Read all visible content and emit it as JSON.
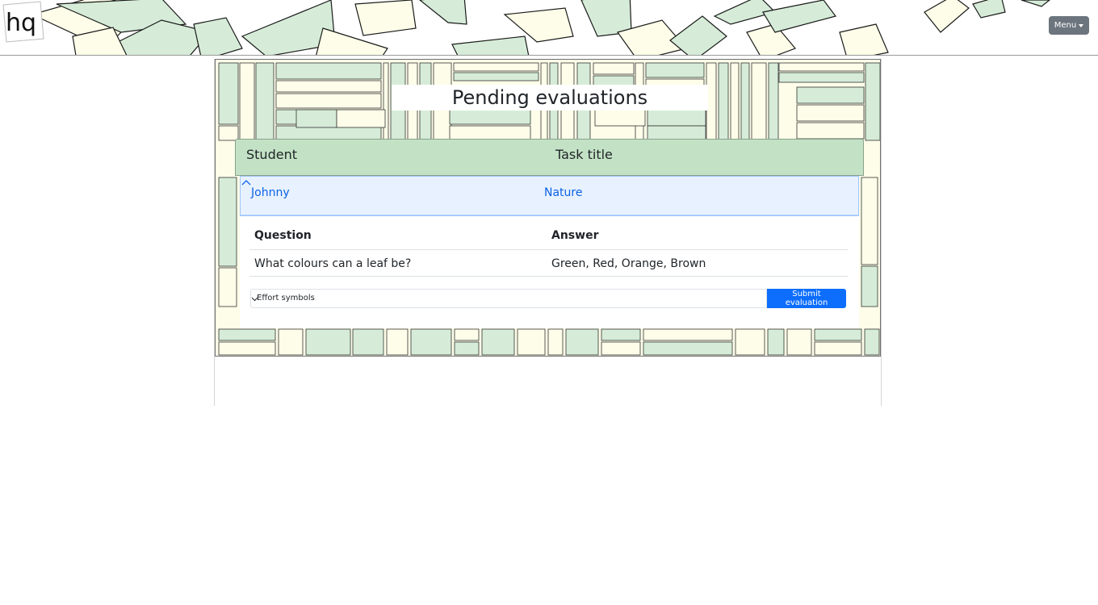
{
  "header": {
    "logo_text": "hq",
    "menu_label": "Menu",
    "colors": {
      "leaf_fill": "#d6ecd8",
      "paper_fill": "#fdfde9",
      "stroke": "#1a1a1a"
    },
    "icons": {
      "menu_caret": "caret-down-icon"
    }
  },
  "page": {
    "title": "Pending evaluations"
  },
  "evaluations_table": {
    "columns": [
      "Student",
      "Task title"
    ],
    "rows": [
      {
        "student": "Johnny",
        "task": "Nature",
        "expanded": true,
        "toggle_icon": "chevron-up-icon",
        "qa_columns": [
          "Question",
          "Answer"
        ],
        "qa_rows": [
          {
            "question": "What colours can a leaf be?",
            "answer": "Green, Red, Orange, Brown"
          }
        ],
        "evaluation_select": {
          "selected": "Effort symbols",
          "icon": "chevron-down-icon"
        },
        "submit_label": "Submit evaluation"
      }
    ]
  },
  "colors": {
    "header_row_bg": "#c3e2c5",
    "accordion_active_bg": "#e7f1ff",
    "accordion_active_text": "#0c63e4",
    "submit_button_bg": "#0d6efd",
    "menu_button_bg": "#6c757d",
    "pattern_green": "#d6ecd8",
    "pattern_cream": "#fdfde9"
  }
}
